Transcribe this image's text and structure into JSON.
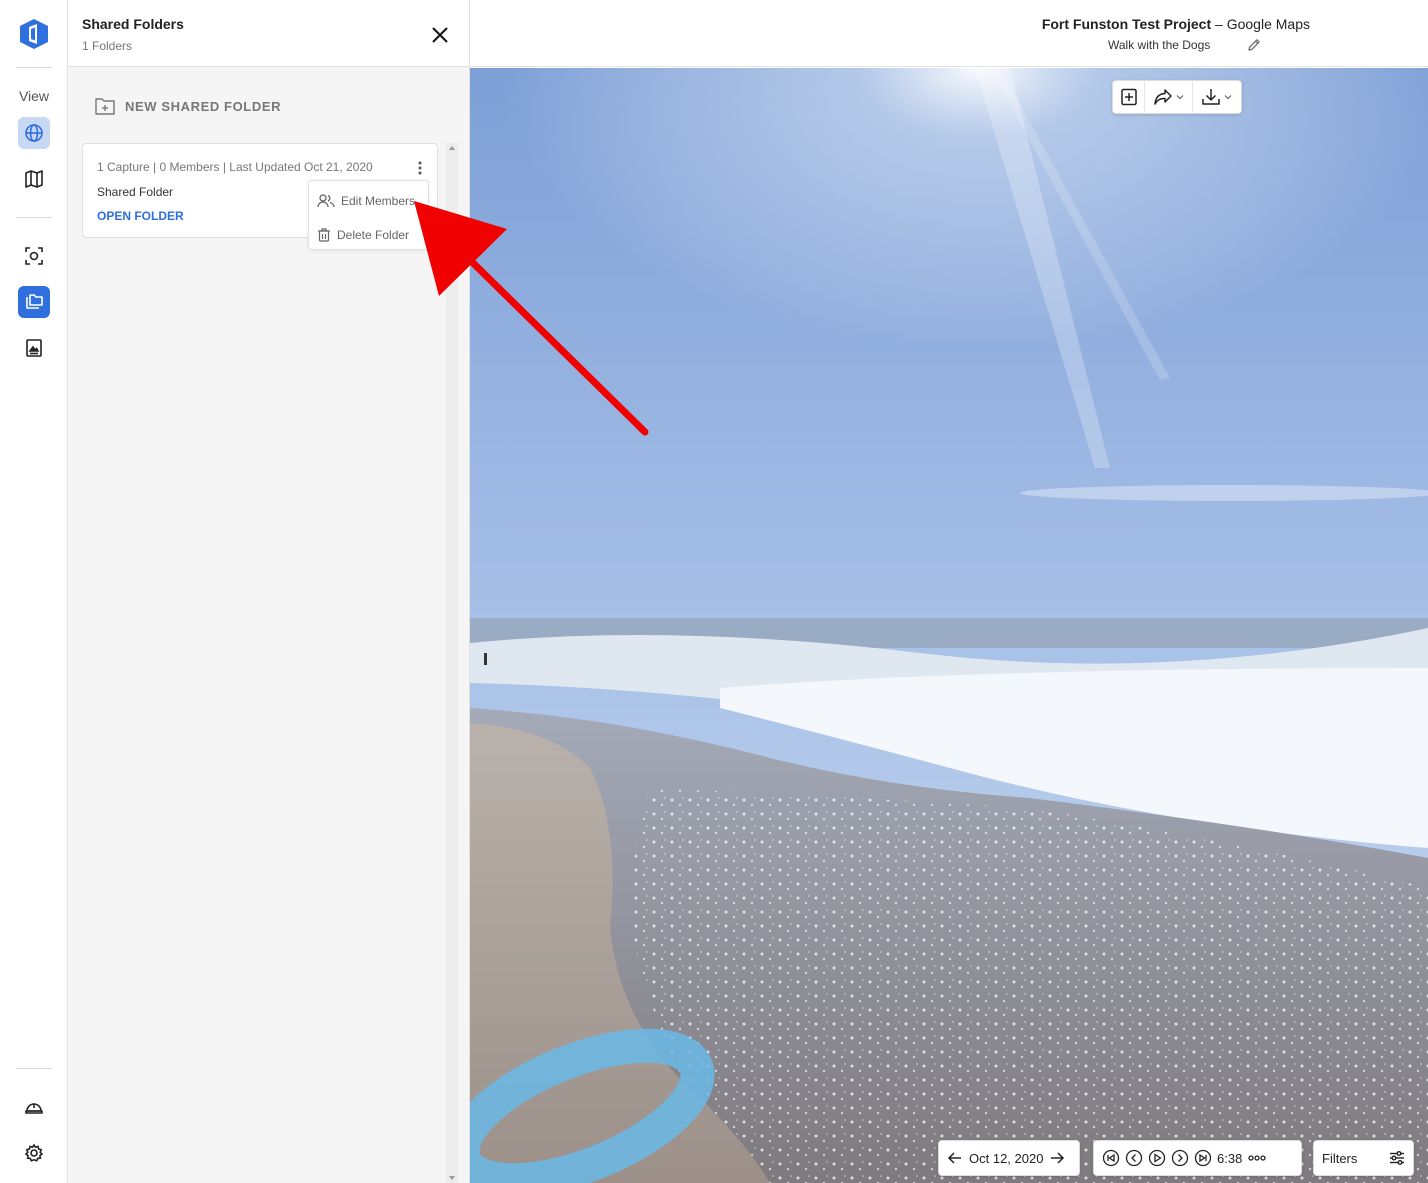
{
  "rail": {
    "view_label": "View",
    "items": [
      {
        "icon": "globe-icon",
        "active": "light"
      },
      {
        "icon": "map-icon"
      },
      {
        "icon": "capture-icon"
      },
      {
        "icon": "shared-folders-icon",
        "active": "dark"
      },
      {
        "icon": "report-icon"
      },
      {
        "icon": "helmet-icon"
      },
      {
        "icon": "gear-icon"
      }
    ]
  },
  "panel": {
    "title": "Shared Folders",
    "subtitle": "1 Folders",
    "new_folder_label": "NEW SHARED FOLDER",
    "folders": [
      {
        "meta": "1 Capture | 0 Members | Last Updated Oct 21, 2020",
        "name": "Shared Folder",
        "open_label": "OPEN FOLDER"
      }
    ],
    "menu": {
      "edit_members": "Edit Members",
      "delete_folder": "Delete Folder"
    }
  },
  "header": {
    "project_name": "Fort Funston Test Project",
    "separator": " – ",
    "project_suffix": "Google Maps",
    "walk_name": "Walk with the Dogs"
  },
  "viewer": {
    "date": "Oct 12, 2020",
    "time": "6:38",
    "filters_label": "Filters"
  },
  "colors": {
    "accent": "#2f6fde",
    "accent_light": "#c7d8f5",
    "annotation_arrow": "#f00000"
  }
}
